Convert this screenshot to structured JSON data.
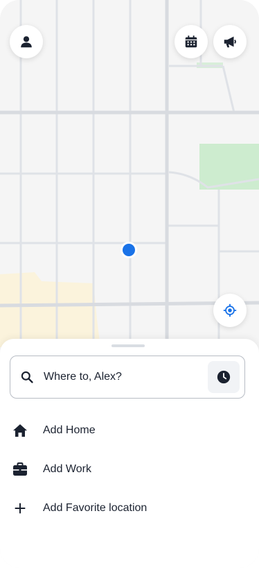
{
  "map": {
    "user_location": "current-location-dot",
    "colors": {
      "road": "#d8dbe0",
      "park": "#cdeccf",
      "sand": "#fbf3dc",
      "dot": "#1a73e8"
    }
  },
  "buttons": {
    "profile": {
      "icon": "person-icon"
    },
    "calendar": {
      "icon": "calendar-icon"
    },
    "announcements": {
      "icon": "megaphone-icon"
    },
    "locate": {
      "icon": "locate-target-icon"
    }
  },
  "search": {
    "placeholder": "Where to, Alex?",
    "icon": "search-icon",
    "schedule_icon": "clock-icon"
  },
  "shortcuts": [
    {
      "label": "Add Home",
      "icon": "home-icon"
    },
    {
      "label": "Add Work",
      "icon": "briefcase-icon"
    },
    {
      "label": "Add Favorite location",
      "icon": "plus-icon"
    }
  ]
}
